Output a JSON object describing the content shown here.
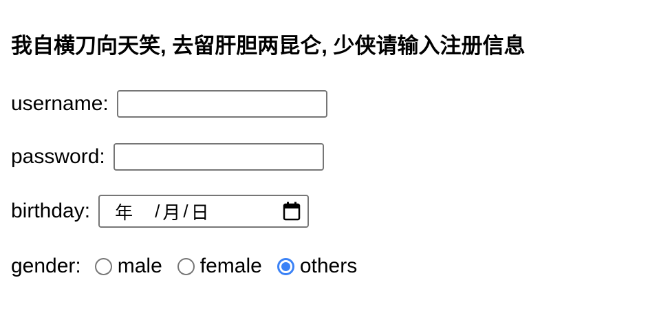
{
  "form": {
    "title": "我自横刀向天笑, 去留肝胆两昆仑, 少侠请输入注册信息",
    "username": {
      "label": "username:",
      "value": ""
    },
    "password": {
      "label": "password:",
      "value": ""
    },
    "birthday": {
      "label": "birthday:",
      "year": "年",
      "month": "月",
      "day": "日",
      "separator": "/",
      "icon": "calendar-icon"
    },
    "gender": {
      "label": "gender:",
      "options": [
        {
          "label": "male",
          "checked": false
        },
        {
          "label": "female",
          "checked": false
        },
        {
          "label": "others",
          "checked": true
        }
      ],
      "checked_color": "#3b82f6"
    }
  }
}
